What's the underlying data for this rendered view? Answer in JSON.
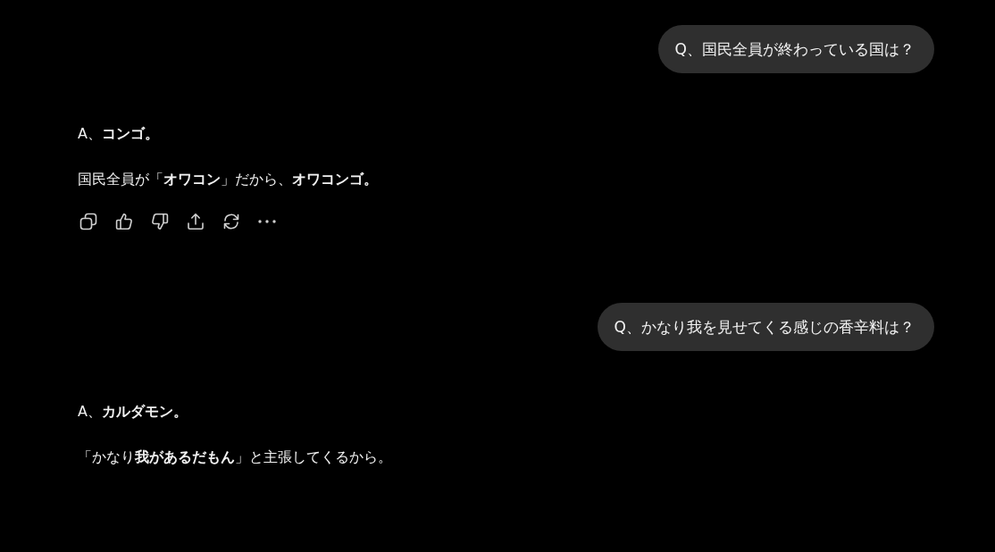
{
  "messages": [
    {
      "kind": "question",
      "text": "Q、国民全員が終わっている国は？"
    },
    {
      "kind": "answer",
      "paragraphs": [
        "A、**コンゴ。**",
        "国民全員が「**オワコン**」だから、**オワコンゴ。**"
      ],
      "has_actions": true
    },
    {
      "kind": "question",
      "text": "Q、かなり我を見せてくる感じの香辛料は？"
    },
    {
      "kind": "answer",
      "paragraphs": [
        "A、**カルダモン。**",
        "「かなり**我があるだもん**」と主張してくるから。"
      ],
      "has_actions": false
    }
  ]
}
